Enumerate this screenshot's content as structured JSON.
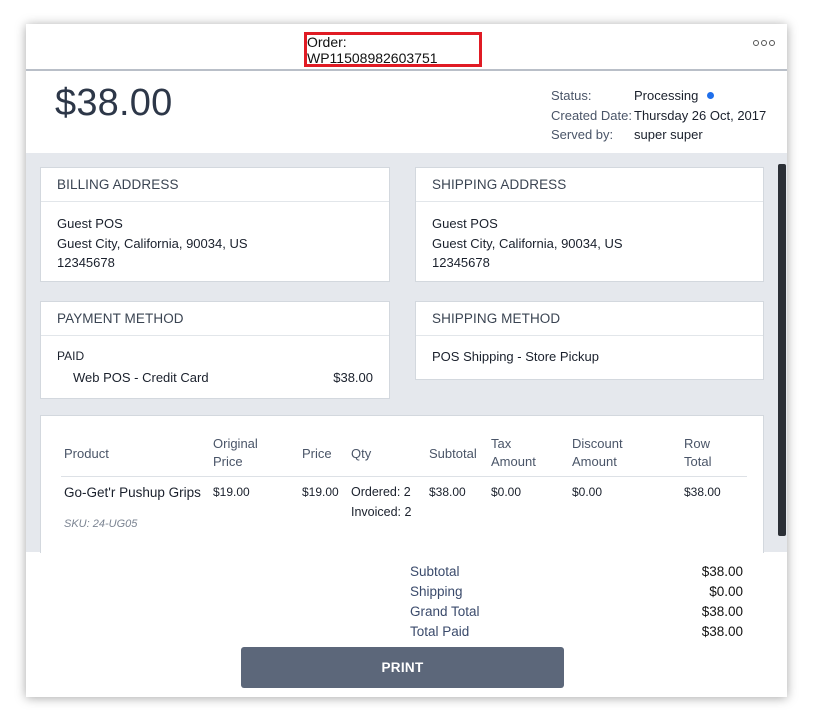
{
  "order": {
    "label": "Order: WP11508982603751"
  },
  "summary": {
    "amount": "$38.00",
    "status_label": "Status:",
    "status_value": "Processing",
    "created_label": "Created Date:",
    "created_value": "Thursday 26 Oct, 2017",
    "served_label": "Served by:",
    "served_value": "super super"
  },
  "billing": {
    "title": "BILLING ADDRESS",
    "name": "Guest POS",
    "address": "Guest City, California, 90034, US",
    "phone": "12345678"
  },
  "shipping": {
    "title": "SHIPPING ADDRESS",
    "name": "Guest POS",
    "address": "Guest City, California, 90034, US",
    "phone": "12345678"
  },
  "payment": {
    "title": "PAYMENT METHOD",
    "state": "PAID",
    "method": "Web POS - Credit Card",
    "amount": "$38.00"
  },
  "shipping_method": {
    "title": "SHIPPING METHOD",
    "value": "POS Shipping - Store Pickup"
  },
  "products": {
    "headers": {
      "product": "Product",
      "original_price_1": "Original",
      "original_price_2": "Price",
      "price": "Price",
      "qty": "Qty",
      "subtotal": "Subtotal",
      "tax_1": "Tax",
      "tax_2": "Amount",
      "discount_1": "Discount",
      "discount_2": "Amount",
      "row_total_1": "Row",
      "row_total_2": "Total"
    },
    "rows": [
      {
        "name": "Go-Get'r Pushup Grips",
        "sku": "SKU: 24-UG05",
        "original_price": "$19.00",
        "price": "$19.00",
        "qty_ordered": "Ordered: 2",
        "qty_invoiced": "Invoiced: 2",
        "subtotal": "$38.00",
        "tax": "$0.00",
        "discount": "$0.00",
        "row_total": "$38.00"
      }
    ]
  },
  "totals": {
    "subtotal_label": "Subtotal",
    "subtotal_value": "$38.00",
    "shipping_label": "Shipping",
    "shipping_value": "$0.00",
    "grand_label": "Grand Total",
    "grand_value": "$38.00",
    "paid_label": "Total Paid",
    "paid_value": "$38.00"
  },
  "actions": {
    "print_label": "PRINT"
  },
  "colors": {
    "highlight": "#e01b24",
    "status_dot": "#1f6feb",
    "button": "#5c677a"
  }
}
